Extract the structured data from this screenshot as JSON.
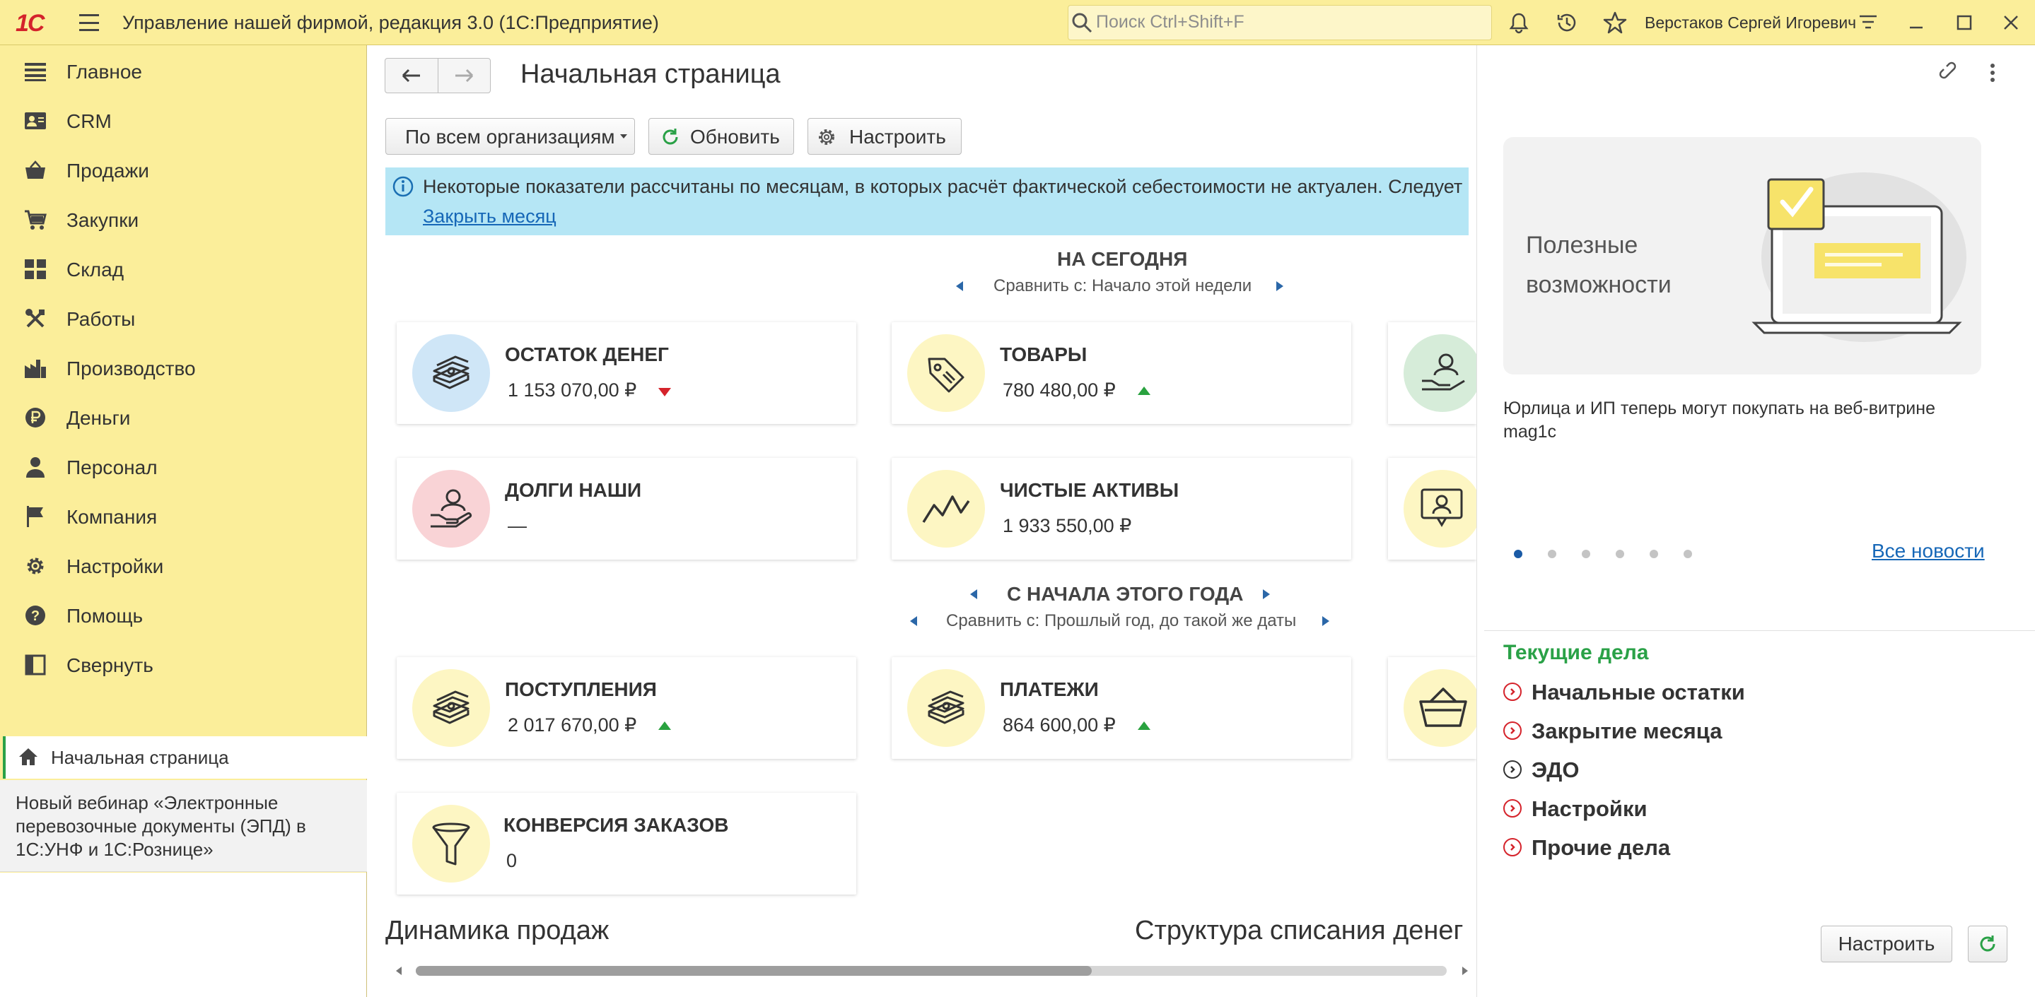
{
  "titlebar": {
    "logo": "1С",
    "app_title": "Управление нашей фирмой, редакция 3.0  (1С:Предприятие)",
    "search_placeholder": "Поиск Ctrl+Shift+F",
    "user_name": "Верстаков Сергей Игоревич"
  },
  "sidebar": {
    "items": [
      {
        "label": "Главное",
        "icon": "list-icon"
      },
      {
        "label": "CRM",
        "icon": "contacts-icon"
      },
      {
        "label": "Продажи",
        "icon": "basket-icon"
      },
      {
        "label": "Закупки",
        "icon": "cart-icon"
      },
      {
        "label": "Склад",
        "icon": "warehouse-icon"
      },
      {
        "label": "Работы",
        "icon": "tools-icon"
      },
      {
        "label": "Производство",
        "icon": "factory-icon"
      },
      {
        "label": "Деньги",
        "icon": "ruble-icon"
      },
      {
        "label": "Персонал",
        "icon": "person-icon"
      },
      {
        "label": "Компания",
        "icon": "flag-icon"
      },
      {
        "label": "Настройки",
        "icon": "gear-icon"
      },
      {
        "label": "Помощь",
        "icon": "help-icon"
      },
      {
        "label": "Свернуть",
        "icon": "collapse-icon"
      }
    ],
    "open_tab": "Начальная страница",
    "news": "Новый вебинар «Электронные перевозочные документы (ЭПД) в 1С:УНФ и 1С:Рознице»"
  },
  "main": {
    "page_title": "Начальная страница",
    "org_select": "По всем организациям",
    "refresh_label": "Обновить",
    "settings_label": "Настроить",
    "info_text": "Некоторые показатели рассчитаны по месяцам, в которых расчёт фактической себестоимости не актуален. Следует",
    "info_link": "Закрыть месяц",
    "today": {
      "title": "НА СЕГОДНЯ",
      "compare": "Сравнить с: Начало этой недели"
    },
    "year": {
      "title": "С НАЧАЛА ЭТОГО ГОДА",
      "compare": "Сравнить с: Прошлый год, до такой же даты"
    },
    "cards": [
      {
        "title": "ОСТАТОК ДЕНЕГ",
        "value": "1 153 070,00 ₽",
        "trend": "down",
        "icon": "money-stack-icon",
        "color": "#cfe6f7"
      },
      {
        "title": "ТОВАРЫ",
        "value": "780 480,00 ₽",
        "trend": "up",
        "icon": "price-tag-icon",
        "color": "#fdf6c3"
      },
      {
        "title": "ДОЛГИ НАШИ",
        "value": "—",
        "trend": "none",
        "icon": "hand-person-icon",
        "color": "#f9d3d6"
      },
      {
        "title": "ЧИСТЫЕ АКТИВЫ",
        "value": "1 933 550,00 ₽",
        "trend": "none",
        "icon": "trend-line-icon",
        "color": "#fdf6c3"
      },
      {
        "title": "ПОСТУПЛЕНИЯ",
        "value": "2 017 670,00 ₽",
        "trend": "up",
        "icon": "money-stack-icon",
        "color": "#fdf6c3"
      },
      {
        "title": "ПЛАТЕЖИ",
        "value": "864 600,00 ₽",
        "trend": "up",
        "icon": "money-stack-icon",
        "color": "#fdf6c3"
      },
      {
        "title": "КОНВЕРСИЯ ЗАКАЗОВ",
        "value": "0",
        "trend": "none",
        "icon": "funnel-icon",
        "color": "#fdf6c3"
      }
    ],
    "sales_dynamics": "Динамика продаж",
    "writeoff_structure": "Структура списания денег"
  },
  "right": {
    "promo_title": "Полезные возможности",
    "news_caption": "Юрлица и ИП теперь могут покупать на веб-витрине mag1c",
    "all_news": "Все новости",
    "dots_count": 6,
    "tasks_title": "Текущие дела",
    "tasks": [
      {
        "label": "Начальные остатки",
        "color": "#d5232b"
      },
      {
        "label": "Закрытие месяца",
        "color": "#d5232b"
      },
      {
        "label": "ЭДО",
        "color": "#333333"
      },
      {
        "label": "Настройки",
        "color": "#d5232b"
      },
      {
        "label": "Прочие дела",
        "color": "#d5232b"
      }
    ],
    "settings_btn": "Настроить"
  }
}
